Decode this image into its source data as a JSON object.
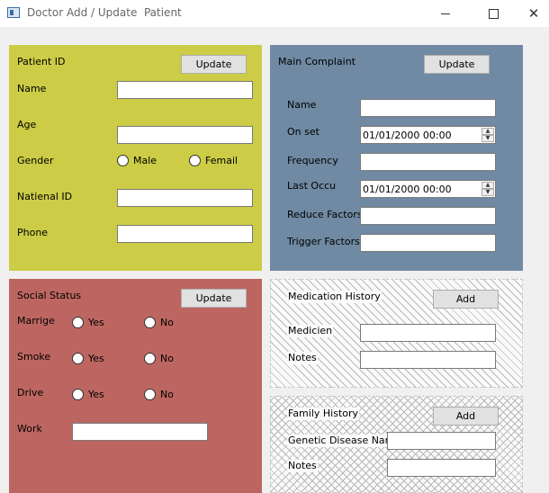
{
  "window": {
    "title": "Doctor Add / Update  Patient",
    "close_glyph": "✕"
  },
  "patient": {
    "id_label": "Patient ID",
    "update_label": "Update",
    "name_label": "Name",
    "age_label": "Age",
    "gender_label": "Gender",
    "male_label": "Male",
    "female_label": "Femail",
    "national_id_label": "Natienal ID",
    "phone_label": "Phone"
  },
  "complaint": {
    "title": "Main Complaint",
    "update_label": "Update",
    "name_label": "Name",
    "onset_label": "On set",
    "onset_value": "01/01/2000 00:00",
    "frequency_label": "Frequency",
    "last_occu_label": "Last Occu",
    "last_occu_value": "01/01/2000 00:00",
    "reduce_label": "Reduce Factors",
    "trigger_label": "Trigger Factors"
  },
  "social": {
    "title": "Social Status",
    "update_label": "Update",
    "marriage_label": "Marrige",
    "smoke_label": "Smoke",
    "drive_label": "Drive",
    "yes_label": "Yes",
    "no_label": "No",
    "work_label": "Work"
  },
  "medication": {
    "title": "Medication History",
    "add_label": "Add",
    "medicine_label": "Medicien",
    "notes_label": "Notes"
  },
  "family": {
    "title": "Family History",
    "add_label": "Add",
    "genetic_label": "Genetic Disease Name",
    "notes_label": "Notes"
  },
  "colors": {
    "patient_panel": "#cccc47",
    "complaint_panel": "#6f8aa2",
    "social_panel": "#bd6661"
  }
}
